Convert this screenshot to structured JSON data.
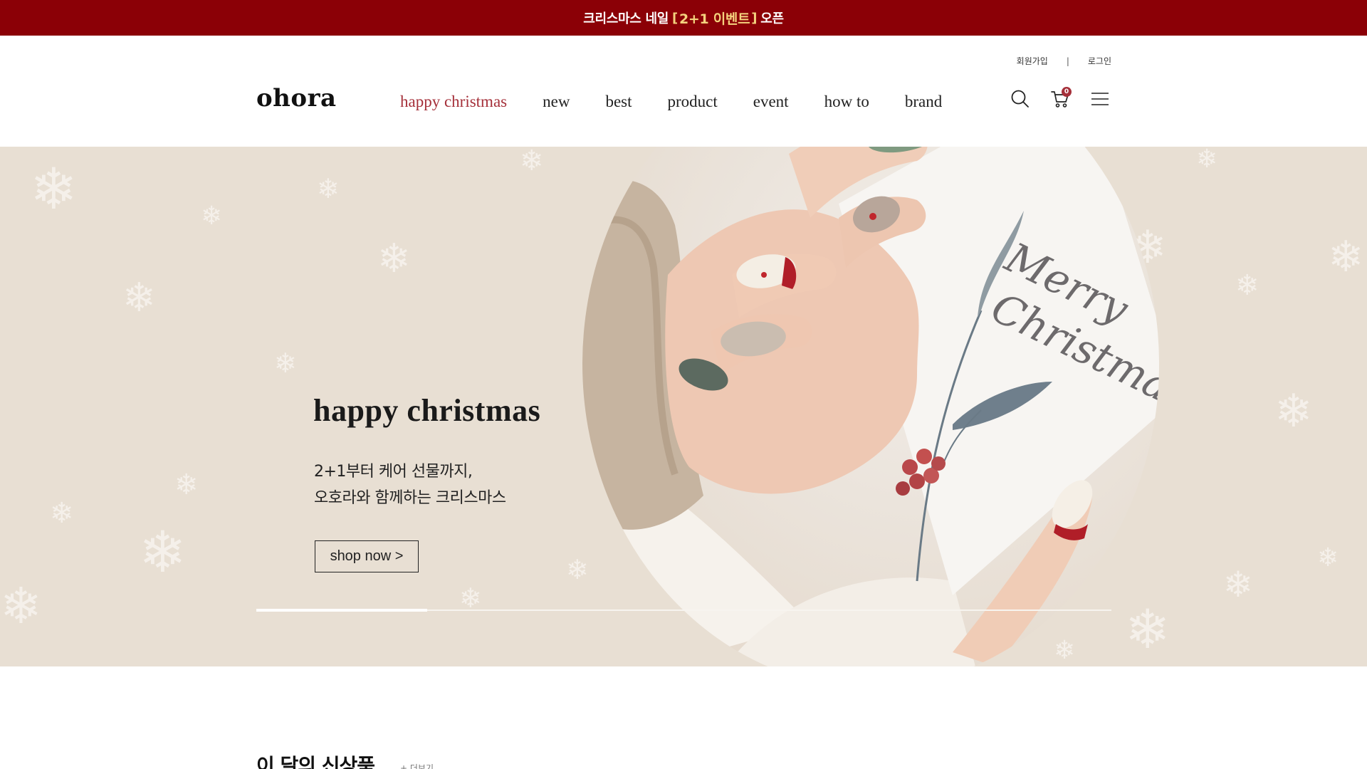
{
  "promo": {
    "part1": "크리스마스 네일",
    "bracket_open": "[",
    "highlight": "2+1 이벤트",
    "bracket_close": "]",
    "part2": "오픈",
    "background": "#8b0006",
    "highlight_color": "#f4d37e"
  },
  "header": {
    "util": {
      "signup": "회원가입",
      "separator": "|",
      "login": "로그인"
    },
    "logo": "ohora",
    "nav": [
      {
        "label": "happy christmas",
        "active": true
      },
      {
        "label": "new"
      },
      {
        "label": "best"
      },
      {
        "label": "product"
      },
      {
        "label": "event"
      },
      {
        "label": "how to"
      },
      {
        "label": "brand"
      }
    ],
    "icons": {
      "search": "search-icon",
      "cart": "cart-icon",
      "menu": "menu-icon"
    },
    "cart_count": "0",
    "accent": "#a5303a"
  },
  "hero": {
    "title": "happy christmas",
    "subtitle_line1": "2+1부터 케어 선물까지,",
    "subtitle_line2": "오호라와 함께하는 크리스마스",
    "cta": "shop now >",
    "background": "#e8dfd3",
    "slide_progress": 0.2
  },
  "section": {
    "title": "이 달의 신상품",
    "more": "+ 더보기"
  }
}
